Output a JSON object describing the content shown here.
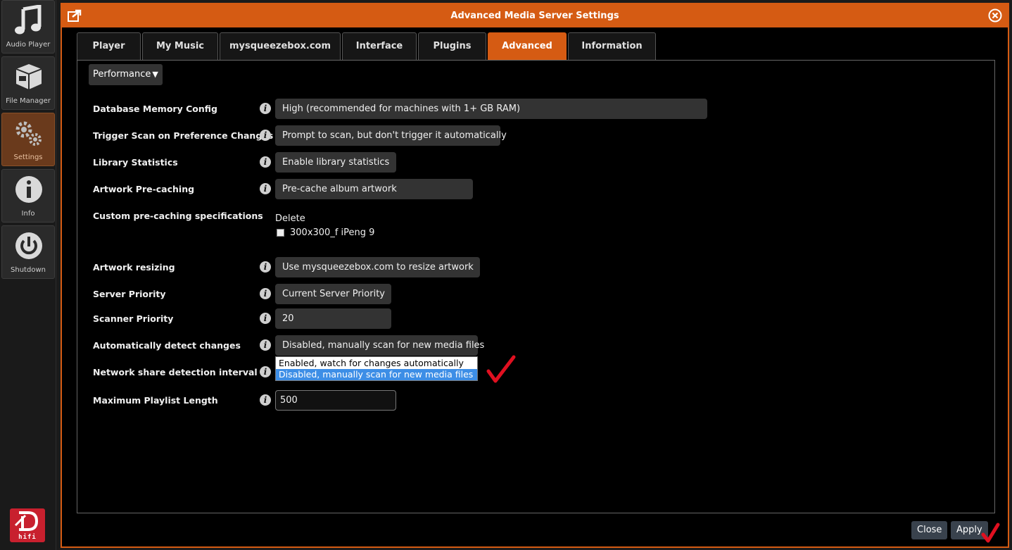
{
  "sidebar": {
    "items": [
      {
        "label": "Audio Player",
        "icon": "music-note-icon"
      },
      {
        "label": "File Manager",
        "icon": "box-icon"
      },
      {
        "label": "Settings",
        "icon": "gears-icon"
      },
      {
        "label": "Info",
        "icon": "info-icon"
      },
      {
        "label": "Shutdown",
        "icon": "power-icon"
      }
    ],
    "active": "Settings",
    "logo_text": "hifi"
  },
  "dialog": {
    "title": "Advanced Media Server Settings",
    "tabs": [
      "Player",
      "My Music",
      "mysqueezebox.com",
      "Interface",
      "Plugins",
      "Advanced",
      "Information"
    ],
    "active_tab": "Advanced",
    "section": "Performance"
  },
  "settings": {
    "database_memory": {
      "label": "Database Memory Config",
      "value": "High (recommended for machines with 1+ GB RAM)"
    },
    "trigger_scan": {
      "label": "Trigger Scan on Preference Changes",
      "value": "Prompt to scan, but don't trigger it automatically"
    },
    "library_stats": {
      "label": "Library Statistics",
      "value": "Enable library statistics"
    },
    "artwork_precache": {
      "label": "Artwork Pre-caching",
      "value": "Pre-cache album artwork"
    },
    "custom_precache": {
      "label": "Custom pre-caching specifications",
      "delete_label": "Delete",
      "item": "300x300_f iPeng 9"
    },
    "artwork_resizing": {
      "label": "Artwork resizing",
      "value": "Use mysqueezebox.com to resize artwork"
    },
    "server_priority": {
      "label": "Server Priority",
      "value": "Current Server Priority"
    },
    "scanner_priority": {
      "label": "Scanner Priority",
      "value": "20"
    },
    "auto_detect": {
      "label": "Automatically detect changes",
      "value": "Disabled, manually scan for new media files",
      "options": [
        "Enabled, watch for changes automatically",
        "Disabled, manually scan for new media files"
      ],
      "highlighted": "Disabled, manually scan for new media files"
    },
    "network_share": {
      "label": "Network share detection interval"
    },
    "max_playlist": {
      "label": "Maximum Playlist Length",
      "value": "500"
    }
  },
  "footer": {
    "close_label": "Close",
    "apply_label": "Apply"
  },
  "colors": {
    "accent": "#d55b13",
    "highlight": "#3d8ee6",
    "annotation": "#e01020"
  }
}
